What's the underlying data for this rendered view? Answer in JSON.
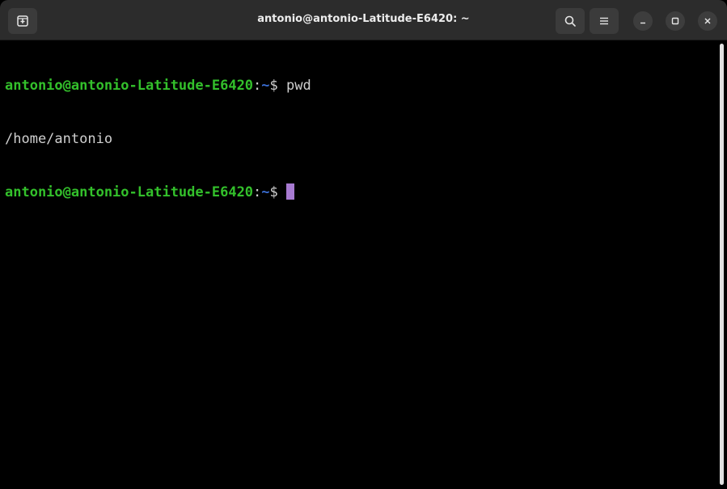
{
  "window": {
    "title": "antonio@antonio-Latitude-E6420: ~"
  },
  "icons": {
    "new_tab": "new-tab-icon",
    "search": "search-icon",
    "menu": "hamburger-menu-icon",
    "minimize": "minimize-icon",
    "maximize": "maximize-icon",
    "close": "close-icon"
  },
  "terminal": {
    "lines": [
      {
        "user_host": "antonio@antonio-Latitude-E6420",
        "colon": ":",
        "path": "~",
        "dollar": "$ ",
        "command": "pwd"
      },
      {
        "output": "/home/antonio"
      },
      {
        "user_host": "antonio@antonio-Latitude-E6420",
        "colon": ":",
        "path": "~",
        "dollar": "$ ",
        "command": ""
      }
    ]
  },
  "colors": {
    "titlebar": "#2c2c2c",
    "background": "#000000",
    "prompt_user": "#33c02b",
    "prompt_path": "#3b6fd6",
    "text": "#d0d0d0",
    "cursor": "#a77ad1"
  }
}
